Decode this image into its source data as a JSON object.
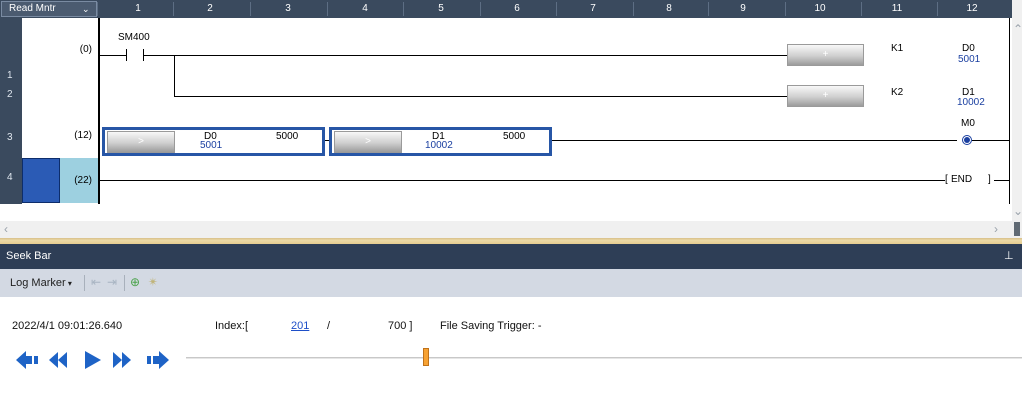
{
  "ladder": {
    "mode_label": "Read Mntr",
    "columns": [
      "1",
      "2",
      "3",
      "4",
      "5",
      "6",
      "7",
      "8",
      "9",
      "10",
      "11",
      "12"
    ],
    "rows": [
      "1",
      "2",
      "3",
      "4"
    ],
    "steps": [
      "(0)",
      "(12)",
      "(22)"
    ],
    "contact_device": "SM400",
    "add1": {
      "op": "+",
      "src": "K1",
      "dst": "D0",
      "dst_value": "5001"
    },
    "add2": {
      "op": "+",
      "src": "K2",
      "dst": "D1",
      "dst_value": "10002"
    },
    "cmp1": {
      "op": ">",
      "dev": "D0",
      "dev_value": "5001",
      "const": "5000"
    },
    "cmp2": {
      "op": ">",
      "dev": "D1",
      "dev_value": "10002",
      "const": "5000"
    },
    "coil_device": "M0",
    "end_label": "END"
  },
  "seek_bar": {
    "title": "Seek Bar",
    "pin_icon": "pin-icon",
    "log_marker": "Log Marker",
    "timestamp": "2022/4/1 09:01:26.640",
    "index_label": "Index:[",
    "index_value": "201",
    "index_sep": "/",
    "index_total": "700 ]",
    "trigger_label": "File Saving Trigger: -",
    "position_fraction": 0.287,
    "accent_color": "#f7a233",
    "control_color": "#1e63c6"
  }
}
